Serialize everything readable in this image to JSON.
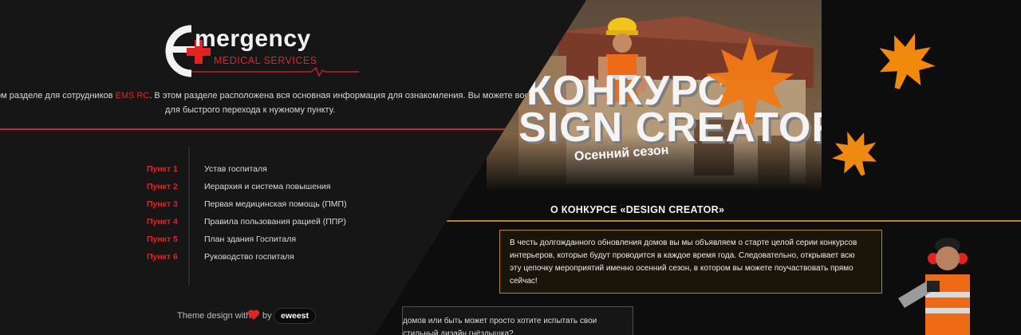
{
  "logo": {
    "title": "mergency",
    "subtitle": "MEDICAL SERVICES"
  },
  "intro": {
    "part1": "ом разделе для сотрудников ",
    "accent": "EMS RC",
    "part2": ". В этом разделе расположена вся основная информация для ознакомления. Вы можете воспользоват",
    "line2": "для быстрого перехода к нужному пункту."
  },
  "toc": [
    {
      "num": "Пункт 1",
      "label": "Устав госпиталя"
    },
    {
      "num": "Пункт 2",
      "label": "Иерархия и система повышения"
    },
    {
      "num": "Пункт 3",
      "label": "Первая медицинская помощь (ПМП)"
    },
    {
      "num": "Пункт 4",
      "label": "Правила пользования рацией (ППР)"
    },
    {
      "num": "Пункт 5",
      "label": "План здания Госпиталя"
    },
    {
      "num": "Пункт 6",
      "label": "Руководство госпиталя"
    }
  ],
  "credit": {
    "text": "Theme design with",
    "by": "by",
    "author": "eweest"
  },
  "banner": {
    "title_line1": "КОНКУРС",
    "title_line2": "SIGN CREATOR",
    "subtitle": "Осенний сезон"
  },
  "contest": {
    "heading": "О КОНКУРСЕ «DESIGN CREATOR»",
    "lines": [
      "В честь долгожданного обновления домов вы мы объявляем о старте целой серии конкурсов",
      "интерьеров, которые будут проводится в каждое время года. Следовательно, открывает всю",
      "эту цепочку мероприятий именно осенний сезон, в котором вы можете поучаствовать прямо",
      "сейчас!"
    ],
    "teaser_lines": [
      "домов или быть может просто хотите испытать свои",
      "стильный дизайн гнёздышка?"
    ]
  },
  "colors": {
    "accent_red": "#e32222",
    "accent_gold": "#b9861c",
    "background": "#161616"
  }
}
